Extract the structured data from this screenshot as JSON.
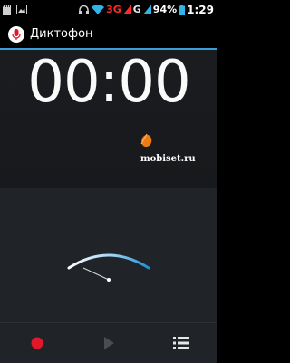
{
  "status_bar": {
    "network_3g": "3G",
    "network_g": "G",
    "battery_percent": "94%",
    "time": "1:29",
    "icons": [
      "sd-card-icon",
      "photo-icon",
      "headset-icon",
      "wifi-icon",
      "signal-icon",
      "battery-icon"
    ]
  },
  "app": {
    "title": "Диктофон",
    "icon": "microphone-icon"
  },
  "recorder": {
    "elapsed": "00:00",
    "level_meter": 0.0
  },
  "watermark": "mobiset.ru",
  "controls": {
    "record": "record-icon",
    "play": "play-icon",
    "list": "list-icon"
  },
  "colors": {
    "accent": "#3a9fd6",
    "record": "#e0182a",
    "network_3g": "#ff2a2a"
  }
}
